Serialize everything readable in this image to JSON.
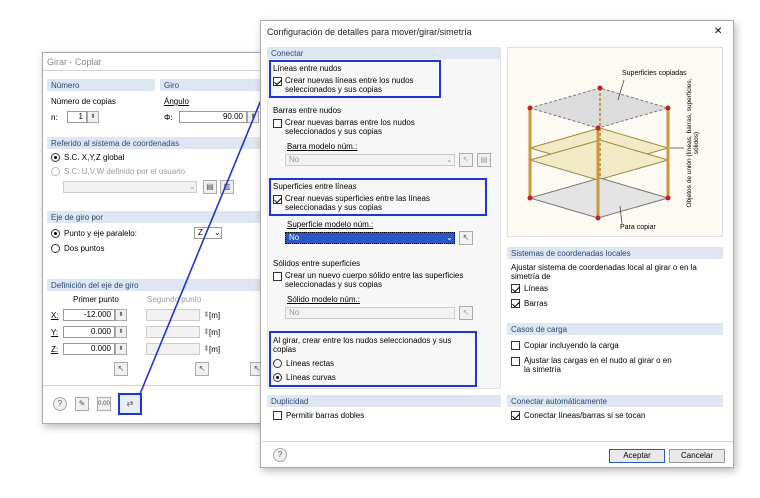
{
  "left": {
    "title": "Girar - Copiar",
    "numero_hdr": "Número",
    "giro_hdr": "Giro",
    "num_copias": "Número de copias",
    "n_lbl": "n:",
    "n_val": "1",
    "angulo": "Ángulo",
    "phi_lbl": "Φ:",
    "phi_val": "90.00",
    "phi_unit": "[°]",
    "ref_hdr": "Referido al sistema de coordenadas",
    "ref_opt1": "S.C. X,Y,Z global",
    "ref_opt2": "S.C. U,V,W definido por el usuario",
    "eje_hdr": "Eje de giro por",
    "eje_opt1": "Punto y eje paralelo:",
    "eje_axis": "Z",
    "eje_opt2": "Dos puntos",
    "def_hdr": "Definición del eje de giro",
    "primer": "Primer punto",
    "segundo": "Segundo punto",
    "rows": [
      {
        "axis": "X:",
        "val": "-12.000",
        "unit": "[m]"
      },
      {
        "axis": "Y:",
        "val": "0.000",
        "unit": "[m]"
      },
      {
        "axis": "Z:",
        "val": "0.000",
        "unit": "[m]"
      }
    ]
  },
  "dialog": {
    "title": "Configuración de detalles para mover/girar/simetría",
    "close": "✕",
    "conectar_hdr": "Conectar",
    "lineas_nudos": "Líneas entre nudos",
    "lineas_cb": "Crear nuevas líneas entre los nudos seleccionados y sus copias",
    "barras_nudos": "Barras entre nudos",
    "barras_cb": "Crear nuevas barras entre los nudos seleccionados y sus copias",
    "barra_modelo": "Barra modelo núm.:",
    "barra_modelo_val": "No",
    "superficies_lineas": "Superficies entre líneas",
    "superficies_cb": "Crear nuevas superficies entre las líneas seleccionadas y sus copias",
    "superficie_modelo": "Superficie modelo núm.:",
    "superficie_modelo_val": "No",
    "solidos": "Sólidos entre superficies",
    "solidos_cb": "Crear un nuevo cuerpo sólido entre las superficies seleccionadas y sus copias",
    "solido_modelo": "Sólido modelo núm.:",
    "solido_modelo_val": "No",
    "al_girar": "Al girar, crear entre los nudos seleccionados y sus copias",
    "lineas_rectas": "Líneas rectas",
    "lineas_curvas": "Líneas curvas",
    "duplicidad_hdr": "Duplicidad",
    "permitir": "Permitir barras dobles",
    "diagram": {
      "sup_copiadas": "Superficies copiadas",
      "objetos": "Objetos de unión (líneas, barras, superficies, sólidos)",
      "para_copiar": "Para copiar"
    },
    "sistemas_hdr": "Sistemas de coordenadas locales",
    "ajustar_sc": "Ajustar sistema de coordenadas local al girar o en la simetría de",
    "sc_lineas": "Líneas",
    "sc_barras": "Barras",
    "casos_hdr": "Casos de carga",
    "copiar_carga": "Copiar incluyendo la carga",
    "ajustar_cargas": "Ajustar las cargas en el nudo al girar o en la simetría",
    "auto_hdr": "Conectar automáticamente",
    "conectar_lb": "Conectar líneas/barras si se tocan",
    "aceptar": "Aceptar",
    "cancelar": "Cancelar"
  },
  "colors": {
    "highlight": "#1f36d6",
    "group_header": "#dde6f1"
  }
}
